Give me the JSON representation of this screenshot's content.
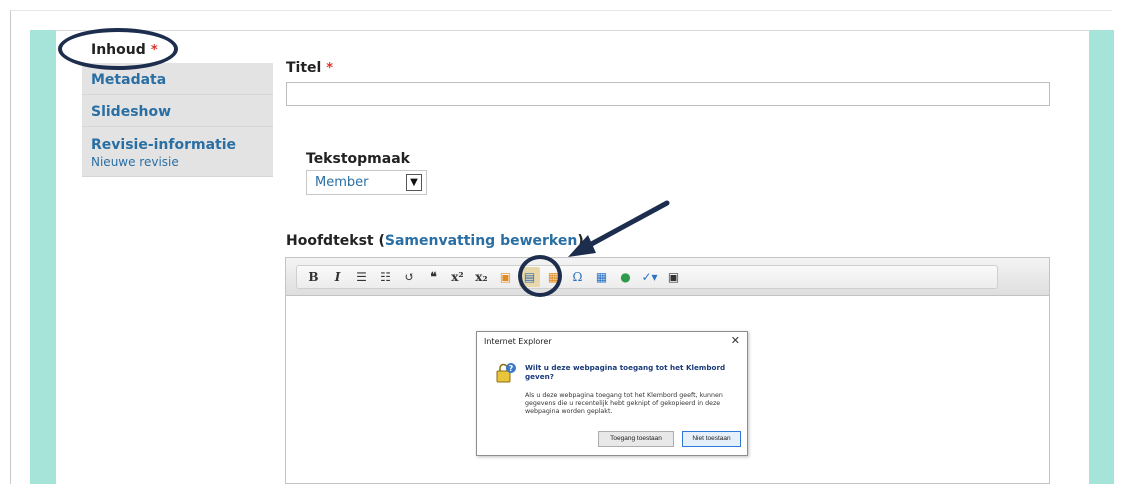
{
  "tabs": [
    {
      "label": "Inhoud",
      "required_mark": "*",
      "active": true
    },
    {
      "label": "Metadata"
    },
    {
      "label": "Slideshow"
    },
    {
      "label": "Revisie-informatie",
      "sub": "Nieuwe revisie"
    }
  ],
  "form": {
    "title_label": "Titel",
    "title_required": "*",
    "title_value": "",
    "format_label": "Tekstopmaak",
    "format_selected": "Member",
    "body_label": "Hoofdtekst",
    "body_paren_open": " (",
    "body_link": "Samenvatting bewerken",
    "body_paren_close": ")"
  },
  "toolbar": {
    "buttons": [
      {
        "name": "bold-button",
        "glyph": "B"
      },
      {
        "name": "italic-button",
        "glyph": "I"
      },
      {
        "name": "bullet-list-button",
        "glyph": "☰"
      },
      {
        "name": "numbered-list-button",
        "glyph": "☷"
      },
      {
        "name": "undo-button",
        "glyph": "↺"
      },
      {
        "name": "blockquote-button",
        "glyph": "❝"
      },
      {
        "name": "superscript-button",
        "glyph": "x²"
      },
      {
        "name": "subscript-button",
        "glyph": "x₂"
      },
      {
        "name": "image-button",
        "glyph": "▣"
      },
      {
        "name": "paste-button",
        "glyph": "▤"
      },
      {
        "name": "paste-word-button",
        "glyph": "▦"
      },
      {
        "name": "special-char-button",
        "glyph": "Ω"
      },
      {
        "name": "table-button",
        "glyph": "▦"
      },
      {
        "name": "globe-button",
        "glyph": "●"
      },
      {
        "name": "spellcheck-button",
        "glyph": "✓▾"
      },
      {
        "name": "maximize-button",
        "glyph": "▣"
      }
    ]
  },
  "dialog": {
    "title": "Internet Explorer",
    "close": "✕",
    "question": "Wilt u deze webpagina toegang tot het Klembord geven?",
    "body": "Als u deze webpagina toegang tot het Klembord geeft, kunnen gegevens die u recentelijk hebt geknipt of gekopieerd in deze webpagina worden geplakt.",
    "allow_label": "Toegang toestaan",
    "deny_label": "Niet toestaan"
  },
  "colors": {
    "accent_bar": "#a6e3d9",
    "link": "#2a6fa4",
    "annotation": "#1c2d4d",
    "required": "#e0332b"
  }
}
